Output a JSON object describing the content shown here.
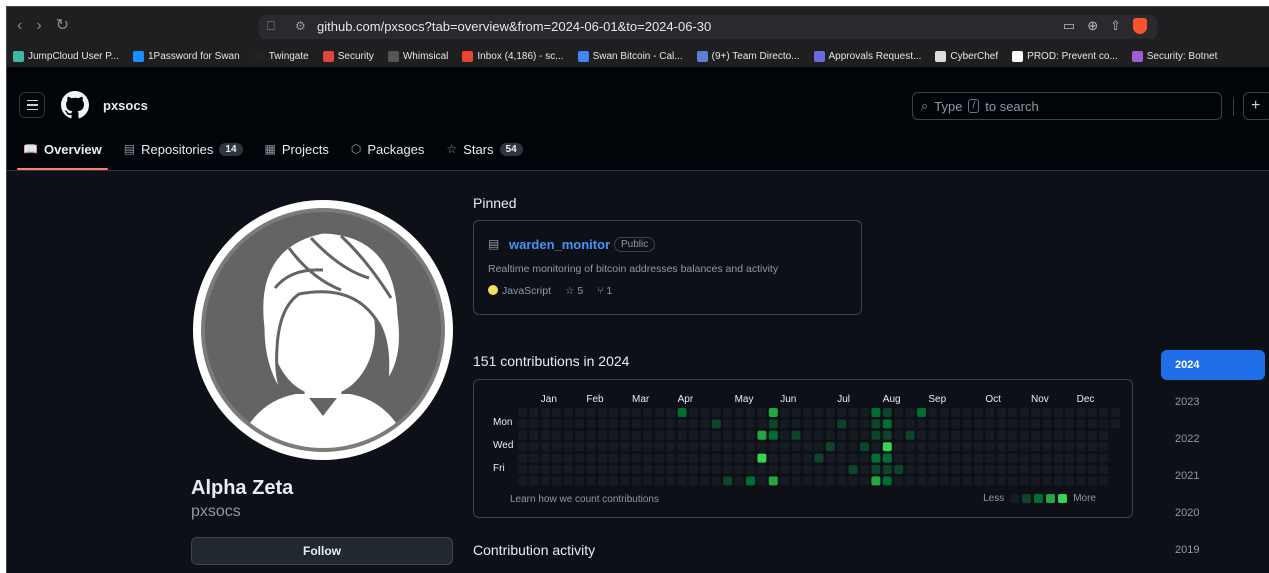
{
  "browser": {
    "url": "github.com/pxsocs?tab=overview&from=2024-06-01&to=2024-06-30",
    "bookmarks": [
      {
        "label": "JumpCloud User P...",
        "color": "#3db8a5"
      },
      {
        "label": "1Password for Swan",
        "color": "#1a8cff"
      },
      {
        "label": "Twingate",
        "color": "#222222"
      },
      {
        "label": "Security",
        "color": "#e0443e"
      },
      {
        "label": "Whimsical",
        "color": "#555555"
      },
      {
        "label": "Inbox (4,186) - sc...",
        "color": "#ea4335"
      },
      {
        "label": "Swan Bitcoin - Cal...",
        "color": "#4285f4"
      },
      {
        "label": "(9+) Team Directo...",
        "color": "#5b7fd6"
      },
      {
        "label": "Approvals Request...",
        "color": "#6a6adf"
      },
      {
        "label": "CyberChef",
        "color": "#dddddd"
      },
      {
        "label": "PROD: Prevent co...",
        "color": "#ffffff"
      },
      {
        "label": "Security: Botnet",
        "color": "#a05cd6"
      }
    ]
  },
  "header": {
    "username": "pxsocs",
    "search_prefix": "Type",
    "search_key": "/",
    "search_suffix": "to search",
    "plus": "+"
  },
  "tabs": [
    {
      "label": "Overview",
      "icon": "book-icon",
      "glyph": "📖",
      "count": "",
      "active": true
    },
    {
      "label": "Repositories",
      "icon": "repo-icon",
      "glyph": "▤",
      "count": "14",
      "active": false
    },
    {
      "label": "Projects",
      "icon": "table-icon",
      "glyph": "▦",
      "count": "",
      "active": false
    },
    {
      "label": "Packages",
      "icon": "package-icon",
      "glyph": "⬡",
      "count": "",
      "active": false
    },
    {
      "label": "Stars",
      "icon": "star-icon",
      "glyph": "☆",
      "count": "54",
      "active": false
    }
  ],
  "profile": {
    "display_name": "Alpha Zeta",
    "login": "pxsocs",
    "follow_label": "Follow"
  },
  "pinned": {
    "title": "Pinned",
    "repo": {
      "name": "warden_monitor",
      "visibility": "Public",
      "description": "Realtime monitoring of bitcoin addresses balances and activity",
      "language": "JavaScript",
      "language_color": "#f1e05a",
      "stars": "5",
      "forks": "1"
    }
  },
  "contributions": {
    "title": "151 contributions in 2024",
    "months": [
      "Jan",
      "Feb",
      "Mar",
      "Apr",
      "May",
      "Jun",
      "Jul",
      "Aug",
      "Sep",
      "Oct",
      "Nov",
      "Dec"
    ],
    "month_weeks": [
      2,
      6,
      10,
      14,
      19,
      23,
      28,
      32,
      36,
      41,
      45,
      49
    ],
    "day_labels": [
      {
        "label": "Mon",
        "row": 1
      },
      {
        "label": "Wed",
        "row": 3
      },
      {
        "label": "Fri",
        "row": 5
      }
    ],
    "learn_text": "Learn how we count contributions",
    "legend_less": "Less",
    "legend_more": "More",
    "level_colors": [
      "#161b22",
      "#0e4429",
      "#006d32",
      "#26a641",
      "#39d353"
    ],
    "weeks": 53,
    "active_cells": [
      [
        14,
        0,
        2
      ],
      [
        22,
        0,
        3
      ],
      [
        31,
        0,
        2
      ],
      [
        32,
        0,
        1
      ],
      [
        35,
        0,
        2
      ],
      [
        17,
        1,
        1
      ],
      [
        22,
        1,
        1
      ],
      [
        28,
        1,
        1
      ],
      [
        31,
        1,
        1
      ],
      [
        32,
        1,
        2
      ],
      [
        21,
        2,
        3
      ],
      [
        22,
        2,
        2
      ],
      [
        24,
        2,
        1
      ],
      [
        31,
        2,
        1
      ],
      [
        32,
        2,
        1
      ],
      [
        34,
        2,
        1
      ],
      [
        27,
        3,
        1
      ],
      [
        30,
        3,
        1
      ],
      [
        32,
        3,
        4
      ],
      [
        21,
        4,
        4
      ],
      [
        26,
        4,
        1
      ],
      [
        31,
        4,
        2
      ],
      [
        32,
        4,
        2
      ],
      [
        29,
        5,
        1
      ],
      [
        31,
        5,
        1
      ],
      [
        32,
        5,
        1
      ],
      [
        33,
        5,
        1
      ],
      [
        18,
        6,
        1
      ],
      [
        20,
        6,
        2
      ],
      [
        22,
        6,
        3
      ],
      [
        31,
        6,
        3
      ],
      [
        32,
        6,
        2
      ]
    ]
  },
  "activity": {
    "title": "Contribution activity"
  },
  "years": [
    {
      "label": "2024",
      "active": true
    },
    {
      "label": "2023",
      "active": false
    },
    {
      "label": "2022",
      "active": false
    },
    {
      "label": "2021",
      "active": false
    },
    {
      "label": "2020",
      "active": false
    },
    {
      "label": "2019",
      "active": false
    }
  ]
}
